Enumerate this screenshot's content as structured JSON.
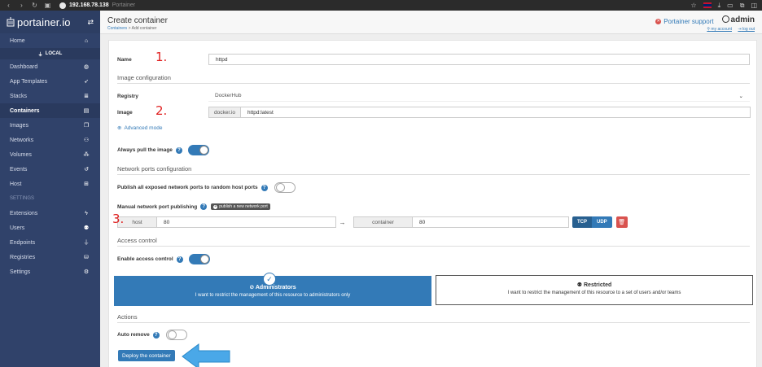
{
  "browser": {
    "url": "192.168.78.138",
    "title": "Portainer"
  },
  "sidebar": {
    "brand": "portainer.io",
    "endpoint": "LOCAL",
    "items": [
      {
        "label": "Home",
        "icon": "home-icon",
        "glyph": "⌂"
      },
      {
        "label": "Dashboard",
        "icon": "dashboard-icon",
        "glyph": "◍"
      },
      {
        "label": "App Templates",
        "icon": "rocket-icon",
        "glyph": "➶"
      },
      {
        "label": "Stacks",
        "icon": "list-icon",
        "glyph": "≣"
      },
      {
        "label": "Containers",
        "icon": "server-icon",
        "glyph": "▤"
      },
      {
        "label": "Images",
        "icon": "clone-icon",
        "glyph": "❐"
      },
      {
        "label": "Networks",
        "icon": "sitemap-icon",
        "glyph": "⚇"
      },
      {
        "label": "Volumes",
        "icon": "cubes-icon",
        "glyph": "⁂"
      },
      {
        "label": "Events",
        "icon": "history-icon",
        "glyph": "↺"
      },
      {
        "label": "Host",
        "icon": "grid-icon",
        "glyph": "⊞"
      }
    ],
    "settings_header": "SETTINGS",
    "settings_items": [
      {
        "label": "Extensions",
        "icon": "bolt-icon",
        "glyph": "ϟ"
      },
      {
        "label": "Users",
        "icon": "users-icon",
        "glyph": "⚉"
      },
      {
        "label": "Endpoints",
        "icon": "plug-icon",
        "glyph": "⏚"
      },
      {
        "label": "Registries",
        "icon": "database-icon",
        "glyph": "⛁"
      },
      {
        "label": "Settings",
        "icon": "cogs-icon",
        "glyph": "⚙"
      }
    ]
  },
  "header": {
    "title": "Create container",
    "breadcrumb_link": "Containers",
    "breadcrumb_rest": " > Add container",
    "support": "Portainer support",
    "user": "admin",
    "my_account": "my account",
    "log_out": "log out"
  },
  "form": {
    "name_label": "Name",
    "name_value": "httpd",
    "image_config_title": "Image configuration",
    "registry_label": "Registry",
    "registry_value": "DockerHub",
    "image_label": "Image",
    "image_prefix": "docker.io",
    "image_value": "httpd:latest",
    "advanced_mode": "Advanced mode",
    "always_pull_label": "Always pull the image",
    "always_pull": true,
    "ports_title": "Network ports configuration",
    "publish_all_label": "Publish all exposed network ports to random host ports",
    "publish_all": false,
    "manual_label": "Manual network port publishing",
    "publish_new_label": "publish a new network port",
    "port_mapping": {
      "host_label": "host",
      "host_value": "80",
      "arrow": "→",
      "container_label": "container",
      "container_value": "80",
      "tcp": "TCP",
      "udp": "UDP"
    },
    "access_title": "Access control",
    "enable_access_label": "Enable access control",
    "enable_access": true,
    "admin_title": "Administrators",
    "admin_desc": "I want to restrict the management of this resource to administrators only",
    "restricted_title": "Restricted",
    "restricted_desc": "I want to restrict the management of this resource to a set of users and/or teams",
    "actions_title": "Actions",
    "auto_remove_label": "Auto remove",
    "auto_remove": false,
    "deploy_label": "Deploy the container"
  },
  "annotations": {
    "one": "1.",
    "two": "2.",
    "three": "3."
  },
  "colors": {
    "sidebar": "#30426a",
    "primary": "#337ab7",
    "danger": "#d9534f",
    "annotation": "#e02020",
    "arrow": "#4aa8e8"
  }
}
